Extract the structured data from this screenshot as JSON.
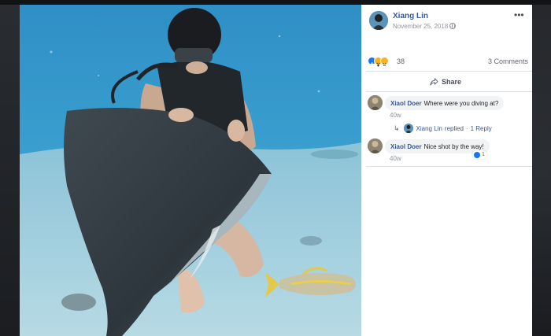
{
  "post": {
    "author_name": "Xiang Lin",
    "date": "November 25, 2018",
    "date_separator": "·",
    "more_glyph": "•••",
    "privacy_icon": "globe-icon"
  },
  "reactions": {
    "icons": [
      "like-icon",
      "wow-icon",
      "sad-icon"
    ],
    "count": "38",
    "comments_label": "3 Comments"
  },
  "actions": {
    "share_label": "Share",
    "share_icon": "share-arrow-icon"
  },
  "comments": [
    {
      "author": "Xiaol Doer",
      "text": "Where were you diving at?",
      "time": "40w",
      "reply": {
        "arrow": "↳",
        "author": "Xiang Lin",
        "action": "replied",
        "separator": "·",
        "count_label": "1 Reply"
      }
    },
    {
      "author": "Xiaol Doer",
      "text": "Nice shot by the way!",
      "time": "40w",
      "likes": "1"
    }
  ],
  "colors": {
    "link": "#385898",
    "like_blue": "#1877f2",
    "muted": "#90949c",
    "bubble": "#f2f3f5"
  }
}
